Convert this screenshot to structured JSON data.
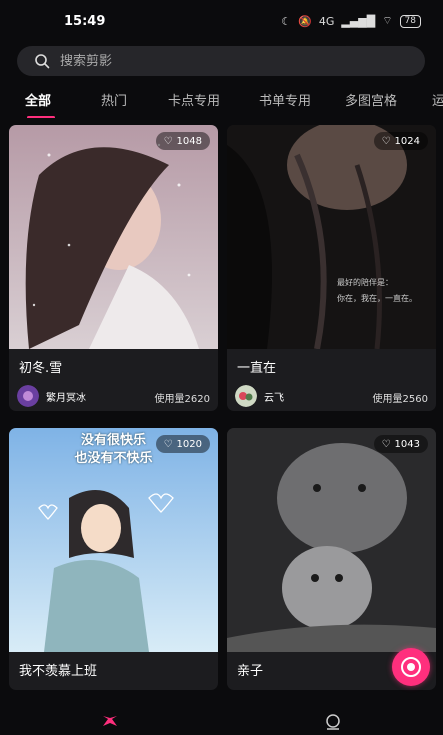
{
  "status": {
    "time": "15:49",
    "network": "4G",
    "battery": "78"
  },
  "search": {
    "placeholder": "搜索剪影"
  },
  "tabs": [
    {
      "label": "全部",
      "active": true
    },
    {
      "label": "热门"
    },
    {
      "label": "卡点专用"
    },
    {
      "label": "书单专用"
    },
    {
      "label": "多图宫格"
    },
    {
      "label": "运"
    }
  ],
  "cards": [
    {
      "title": "初冬.雪",
      "likes": "1048",
      "author": "繁月冥冰",
      "usage": "使用量2620"
    },
    {
      "title": "一直在",
      "likes": "1024",
      "author": "云飞",
      "usage": "使用量2560",
      "overlay_lines": [
        "最好的陪伴是：",
        "你在，我在，一直在。"
      ]
    },
    {
      "title": "我不羡慕上班",
      "likes": "1020",
      "overlay_lines": [
        "没有很快乐",
        "也没有不快乐"
      ]
    },
    {
      "title": "亲子",
      "likes": "1043"
    }
  ],
  "colors": {
    "accent": "#ff2f7d",
    "background": "#0b0b0d",
    "card": "#1c1c1f"
  }
}
